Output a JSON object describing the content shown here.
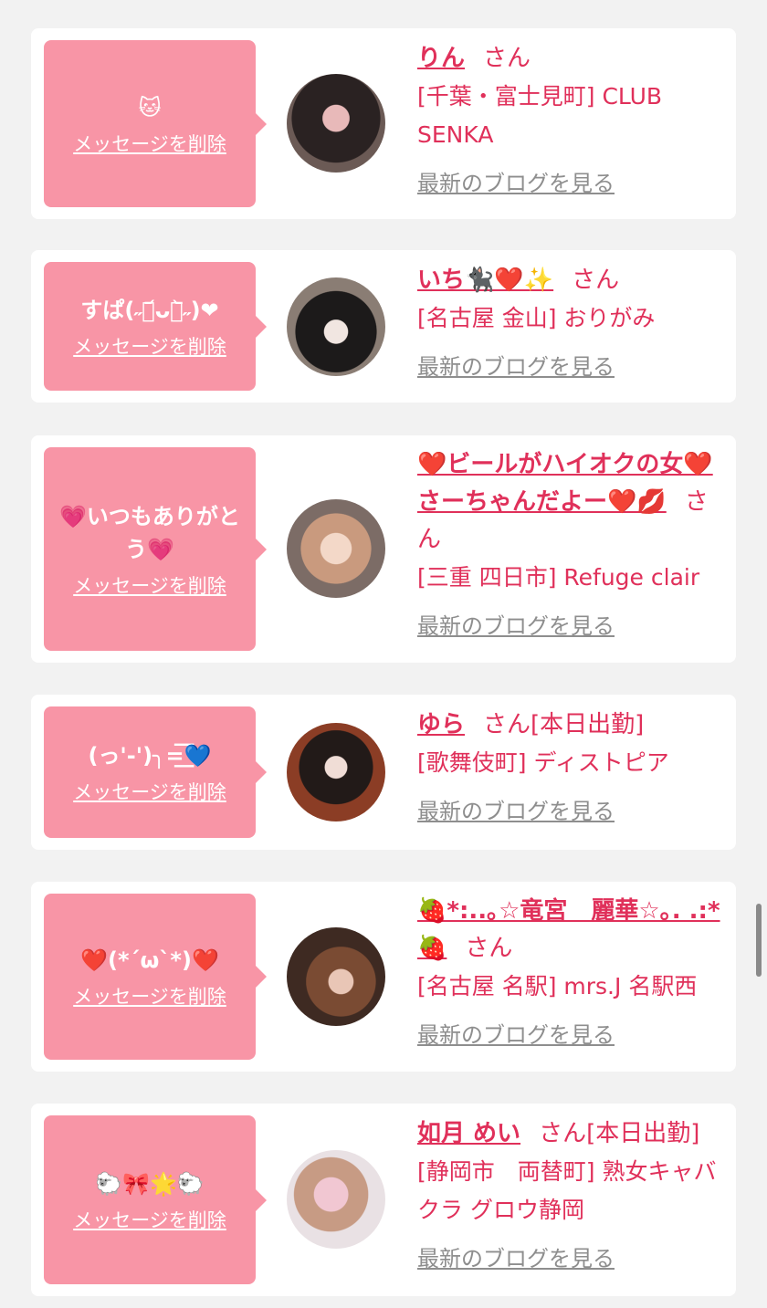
{
  "cards": [
    {
      "message": "🐱",
      "delete_label": "メッセージを削除",
      "name": "りん",
      "honorific": "さん",
      "extra": "",
      "shop": "[千葉・富士見町] CLUB SENKA",
      "blog_label": "最新のブログを見る"
    },
    {
      "message": "すぱ(˶ꈍ᷄ᴗꈍ᷅˶)❤",
      "delete_label": "メッセージを削除",
      "name": "いち🐈‍⬛❤️✨",
      "honorific": "さん",
      "extra": "",
      "shop": "[名古屋 金山] おりがみ",
      "blog_label": "最新のブログを見る"
    },
    {
      "message": "💗いつもありがとう💗",
      "delete_label": "メッセージを削除",
      "name": "❤️ビールがハイオクの女❤️さーちゃんだよー❤️💋",
      "honorific": "さん",
      "extra": "",
      "shop": "[三重 四日市] Refuge clair",
      "blog_label": "最新のブログを見る"
    },
    {
      "message": "(っ'-')╮=͟͟͞͞💙",
      "delete_label": "メッセージを削除",
      "name": "ゆら",
      "honorific": "さん",
      "extra": "[本日出勤]",
      "shop": "[歌舞伎町] ディストピア",
      "blog_label": "最新のブログを見る"
    },
    {
      "message": "❤️(*´ω`*)❤️",
      "delete_label": "メッセージを削除",
      "name": "🍓*:..｡☆竜宮　麗華☆｡. .:*🍓",
      "honorific": "さん",
      "extra": "",
      "shop": "[名古屋 名駅] mrs.J 名駅西",
      "blog_label": "最新のブログを見る"
    },
    {
      "message": "🐑🎀🌟🐑",
      "delete_label": "メッセージを削除",
      "name": "如月 めい",
      "honorific": "さん",
      "extra": "[本日出勤]",
      "shop": "[静岡市　両替町] 熟女キャバクラ グロウ静岡",
      "blog_label": "最新のブログを見る"
    }
  ],
  "colors": {
    "accent": "#e0305a",
    "bubble": "#f895a6",
    "link_gray": "#8e8e8e",
    "background": "#f2f2f2"
  }
}
